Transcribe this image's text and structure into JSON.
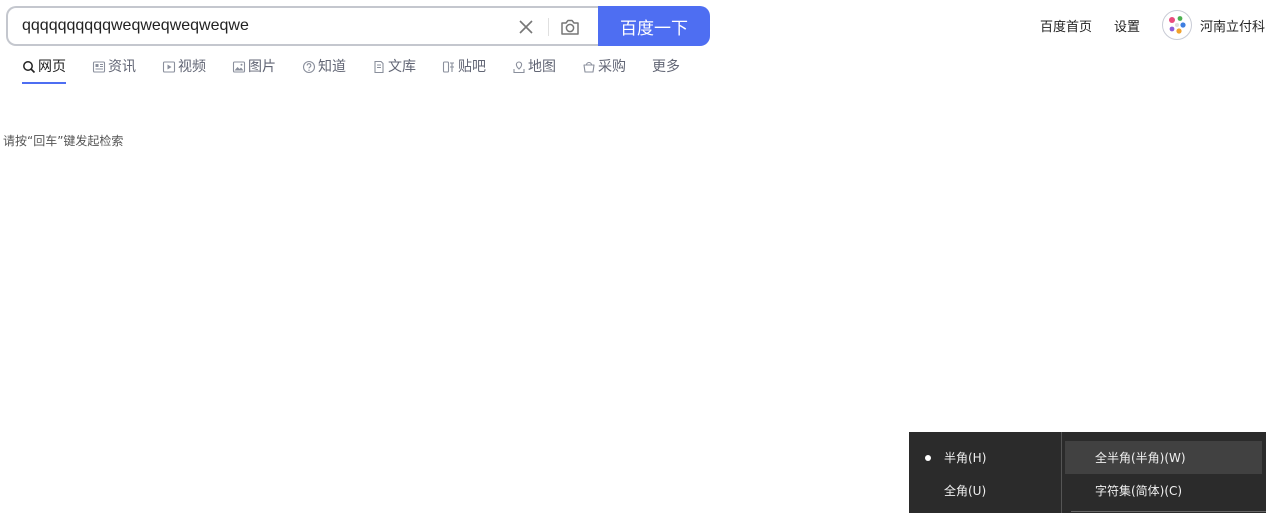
{
  "search": {
    "query": "qqqqqqqqqqweqweqweqweqwe",
    "button_label": "百度一下"
  },
  "tabs": [
    {
      "label": "网页",
      "icon": "search-icon",
      "active": true
    },
    {
      "label": "资讯",
      "icon": "news-icon"
    },
    {
      "label": "视频",
      "icon": "video-icon"
    },
    {
      "label": "图片",
      "icon": "image-icon"
    },
    {
      "label": "知道",
      "icon": "question-icon"
    },
    {
      "label": "文库",
      "icon": "document-icon"
    },
    {
      "label": "贴吧",
      "icon": "tieba-icon"
    },
    {
      "label": "地图",
      "icon": "map-icon"
    },
    {
      "label": "采购",
      "icon": "basket-icon"
    },
    {
      "label": "更多"
    }
  ],
  "hint": "请按“回车”键发起检索",
  "topbar": {
    "home_link": "百度首页",
    "settings_link": "设置",
    "username": "河南立付科"
  },
  "ime_menu": {
    "left": [
      {
        "label": "半角(H)",
        "selected": true
      },
      {
        "label": "全角(U)"
      }
    ],
    "right": [
      {
        "label": "全半角(半角)(W)",
        "highlighted": true
      },
      {
        "label": "字符集(简体)(C)"
      }
    ]
  },
  "colors": {
    "accent": "#4e6ef2",
    "menu_background": "#2b2b2b"
  }
}
